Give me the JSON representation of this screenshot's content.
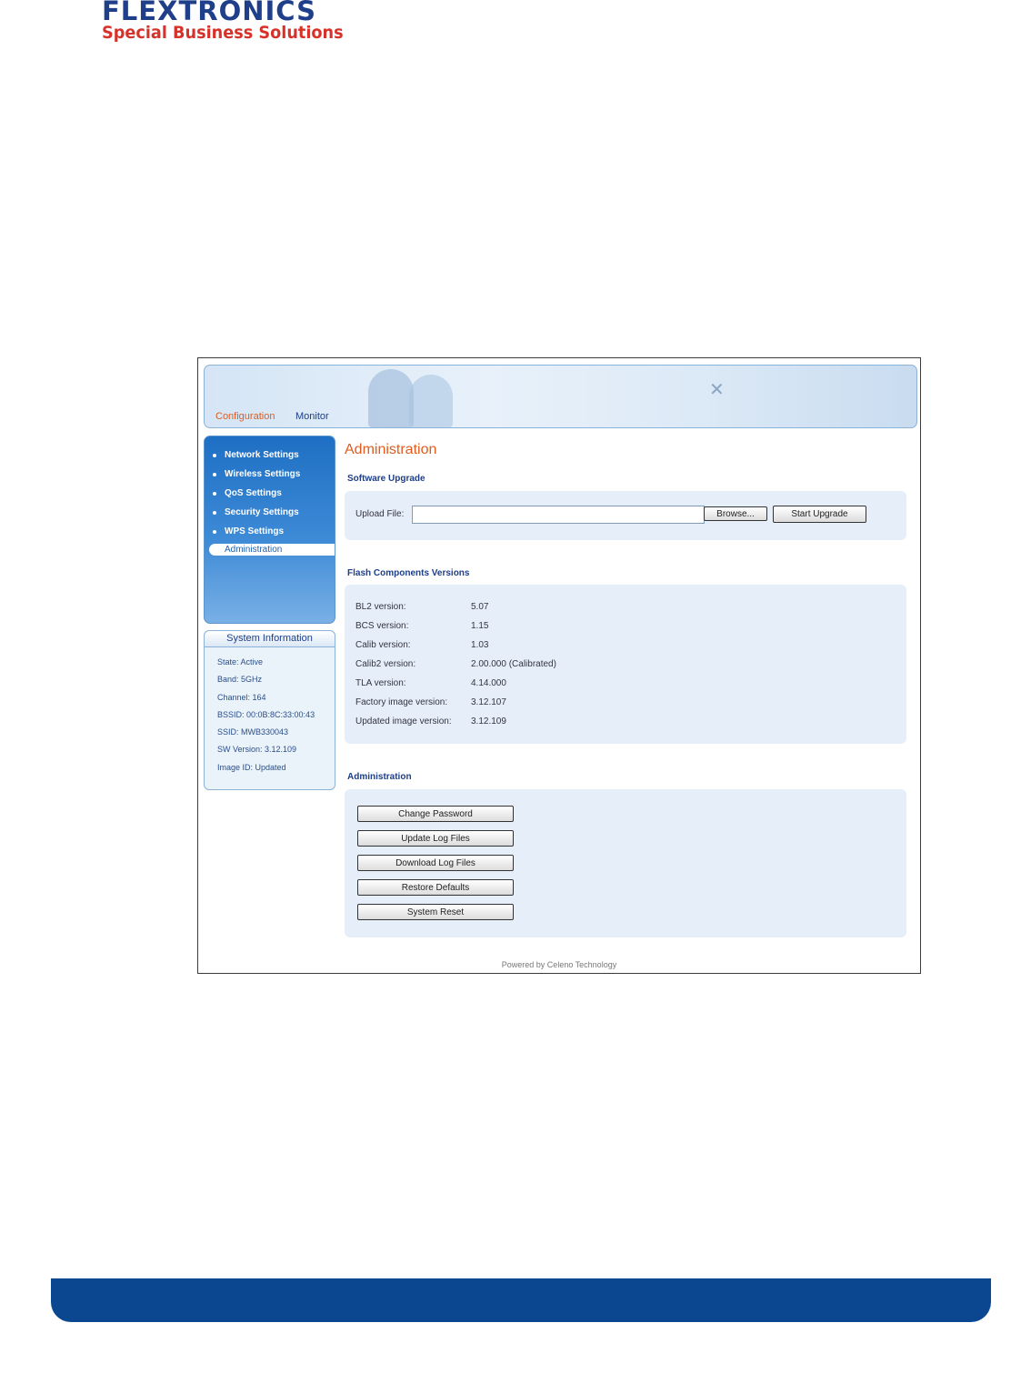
{
  "logo": {
    "main": "FLEXTRONICS",
    "sub": "Special Business Solutions"
  },
  "banner": {
    "nav_configuration": "Configuration",
    "nav_monitor": "Monitor"
  },
  "sidebar": {
    "items": [
      {
        "label": "Network Settings"
      },
      {
        "label": "Wireless Settings"
      },
      {
        "label": "QoS Settings"
      },
      {
        "label": "Security Settings"
      },
      {
        "label": "WPS Settings"
      },
      {
        "label": "Administration"
      }
    ]
  },
  "system_info": {
    "title": "System Information",
    "rows": [
      "State: Active",
      "Band: 5GHz",
      "Channel: 164",
      "BSSID: 00:0B:8C:33:00:43",
      "SSID: MWB330043",
      "SW Version: 3.12.109",
      "Image ID: Updated"
    ]
  },
  "main": {
    "title": "Administration",
    "software_upgrade": {
      "title": "Software Upgrade",
      "upload_label": "Upload File:",
      "upload_value": "",
      "browse_label": "Browse...",
      "start_label": "Start Upgrade"
    },
    "flash": {
      "title": "Flash Components Versions",
      "rows": [
        {
          "label": "BL2 version:",
          "value": "5.07"
        },
        {
          "label": "BCS version:",
          "value": "1.15"
        },
        {
          "label": "Calib version:",
          "value": "1.03"
        },
        {
          "label": "Calib2 version:",
          "value": "2.00.000 (Calibrated)"
        },
        {
          "label": "TLA version:",
          "value": "4.14.000"
        },
        {
          "label": "Factory image version:",
          "value": "3.12.107"
        },
        {
          "label": "Updated image version:",
          "value": "3.12.109"
        }
      ]
    },
    "administration": {
      "title": "Administration",
      "buttons": [
        "Change Password",
        "Update Log Files",
        "Download Log Files",
        "Restore Defaults",
        "System Reset"
      ]
    }
  },
  "footer": "Powered by Celeno Technology"
}
